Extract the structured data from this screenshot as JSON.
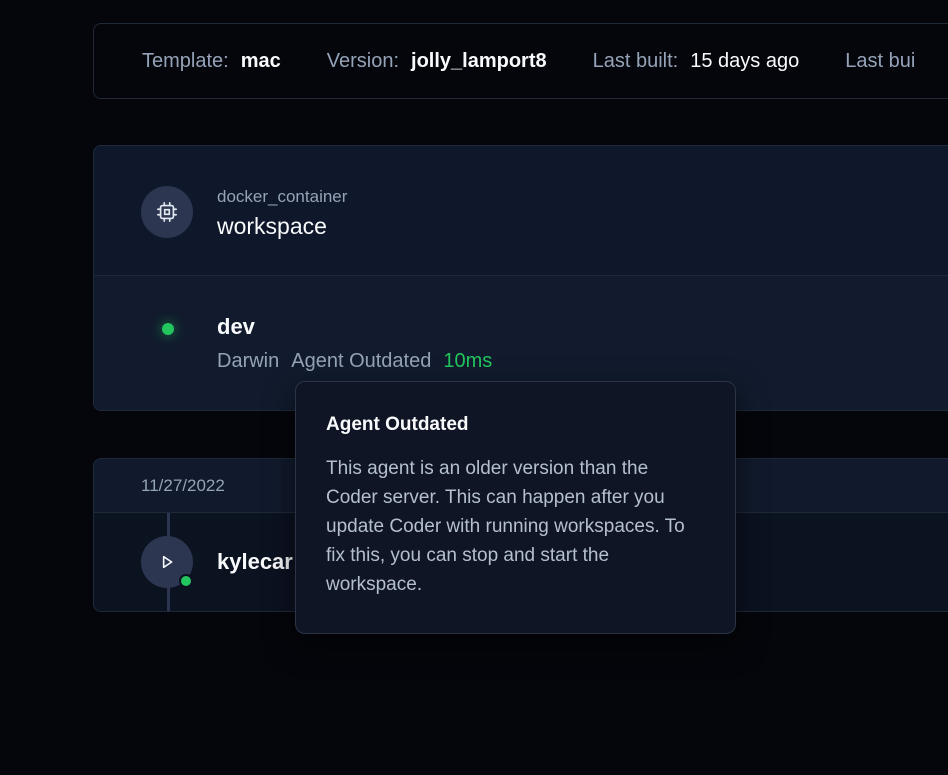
{
  "stats": {
    "template_label": "Template:",
    "template_value": "mac",
    "version_label": "Version:",
    "version_value": "jolly_lamport8",
    "last_built_label": "Last built:",
    "last_built_value": "15 days ago",
    "last_used_label": "Last bui"
  },
  "resource": {
    "icon": "chip-icon",
    "type": "docker_container",
    "name": "workspace"
  },
  "agent": {
    "name": "dev",
    "os": "Darwin",
    "status": "Agent Outdated",
    "latency": "10ms",
    "status_color": "#22c55e"
  },
  "timeline": {
    "date": "11/27/2022",
    "entry_icon": "play-icon",
    "entry_user": "kylecar"
  },
  "tooltip": {
    "title": "Agent Outdated",
    "body": "This agent is an older version than the Coder server. This can happen after you update Coder with running workspaces. To fix this, you can stop and start the workspace."
  }
}
